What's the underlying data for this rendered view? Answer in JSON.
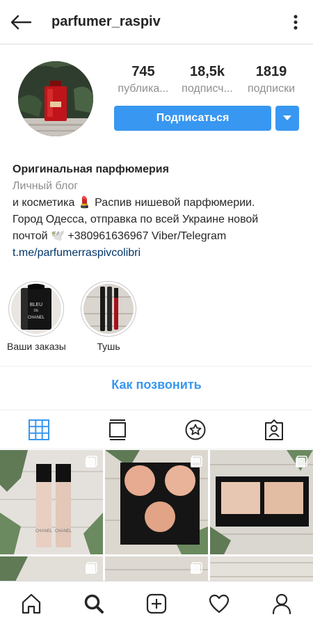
{
  "header": {
    "username": "parfumer_raspiv",
    "back_icon": "arrow-left-icon",
    "menu_icon": "kebab-menu-icon"
  },
  "profile": {
    "stats": [
      {
        "value": "745",
        "label": "публика..."
      },
      {
        "value": "18,5k",
        "label": "подписч..."
      },
      {
        "value": "1819",
        "label": "подписки"
      }
    ],
    "subscribe_label": "Подписаться",
    "dropdown_icon": "caret-down-icon"
  },
  "bio": {
    "name": "Оригинальная парфюмерия",
    "category": "Личный блог",
    "line1": "и косметика 💄 Распив нишевой парфюмерии.",
    "line2": "Город Одесса, отправка по всей Украине новой",
    "line3": "почтой 🕊️ +380961636967 Viber/Telegram",
    "link": "t.me/parfumerraspivcolibri"
  },
  "highlights": [
    {
      "label": "Ваши заказы"
    },
    {
      "label": "Тушь"
    }
  ],
  "call_label": "Как позвонить",
  "tabs": [
    {
      "icon": "grid-icon",
      "active": true
    },
    {
      "icon": "feed-icon",
      "active": false
    },
    {
      "icon": "star-badge-icon",
      "active": false
    },
    {
      "icon": "tagged-person-icon",
      "active": false
    }
  ],
  "bottom_nav": [
    {
      "icon": "home-icon"
    },
    {
      "icon": "search-icon"
    },
    {
      "icon": "add-post-icon"
    },
    {
      "icon": "heart-icon"
    },
    {
      "icon": "profile-icon"
    }
  ],
  "colors": {
    "accent": "#3897f0",
    "text": "#262626",
    "muted": "#8e8e8e"
  }
}
